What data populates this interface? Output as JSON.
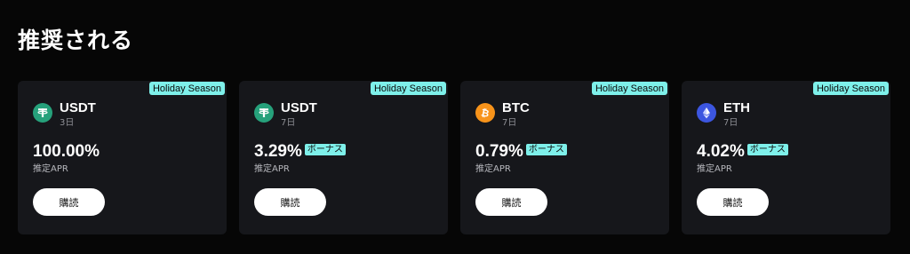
{
  "section": {
    "title": "推奨される"
  },
  "cards": [
    {
      "tag": "Holiday Season",
      "asset": "USDT",
      "icon": "tether-icon",
      "icon_color": "#26a17b",
      "term": "3日",
      "apr": "100.00%",
      "bonus": "",
      "apr_label": "推定APR",
      "button_label": "購読"
    },
    {
      "tag": "Holiday Season",
      "asset": "USDT",
      "icon": "tether-icon",
      "icon_color": "#26a17b",
      "term": "7日",
      "apr": "3.29%",
      "bonus": "ボーナス",
      "apr_label": "推定APR",
      "button_label": "購読"
    },
    {
      "tag": "Holiday Season",
      "asset": "BTC",
      "icon": "bitcoin-icon",
      "icon_color": "#f7931a",
      "term": "7日",
      "apr": "0.79%",
      "bonus": "ボーナス",
      "apr_label": "推定APR",
      "button_label": "購読"
    },
    {
      "tag": "Holiday Season",
      "asset": "ETH",
      "icon": "ethereum-icon",
      "icon_color": "#3c56e0",
      "term": "7日",
      "apr": "4.02%",
      "bonus": "ボーナス",
      "apr_label": "推定APR",
      "button_label": "購読"
    }
  ],
  "colors": {
    "background": "#060606",
    "card": "#16171b",
    "accent": "#7ef0ea"
  }
}
